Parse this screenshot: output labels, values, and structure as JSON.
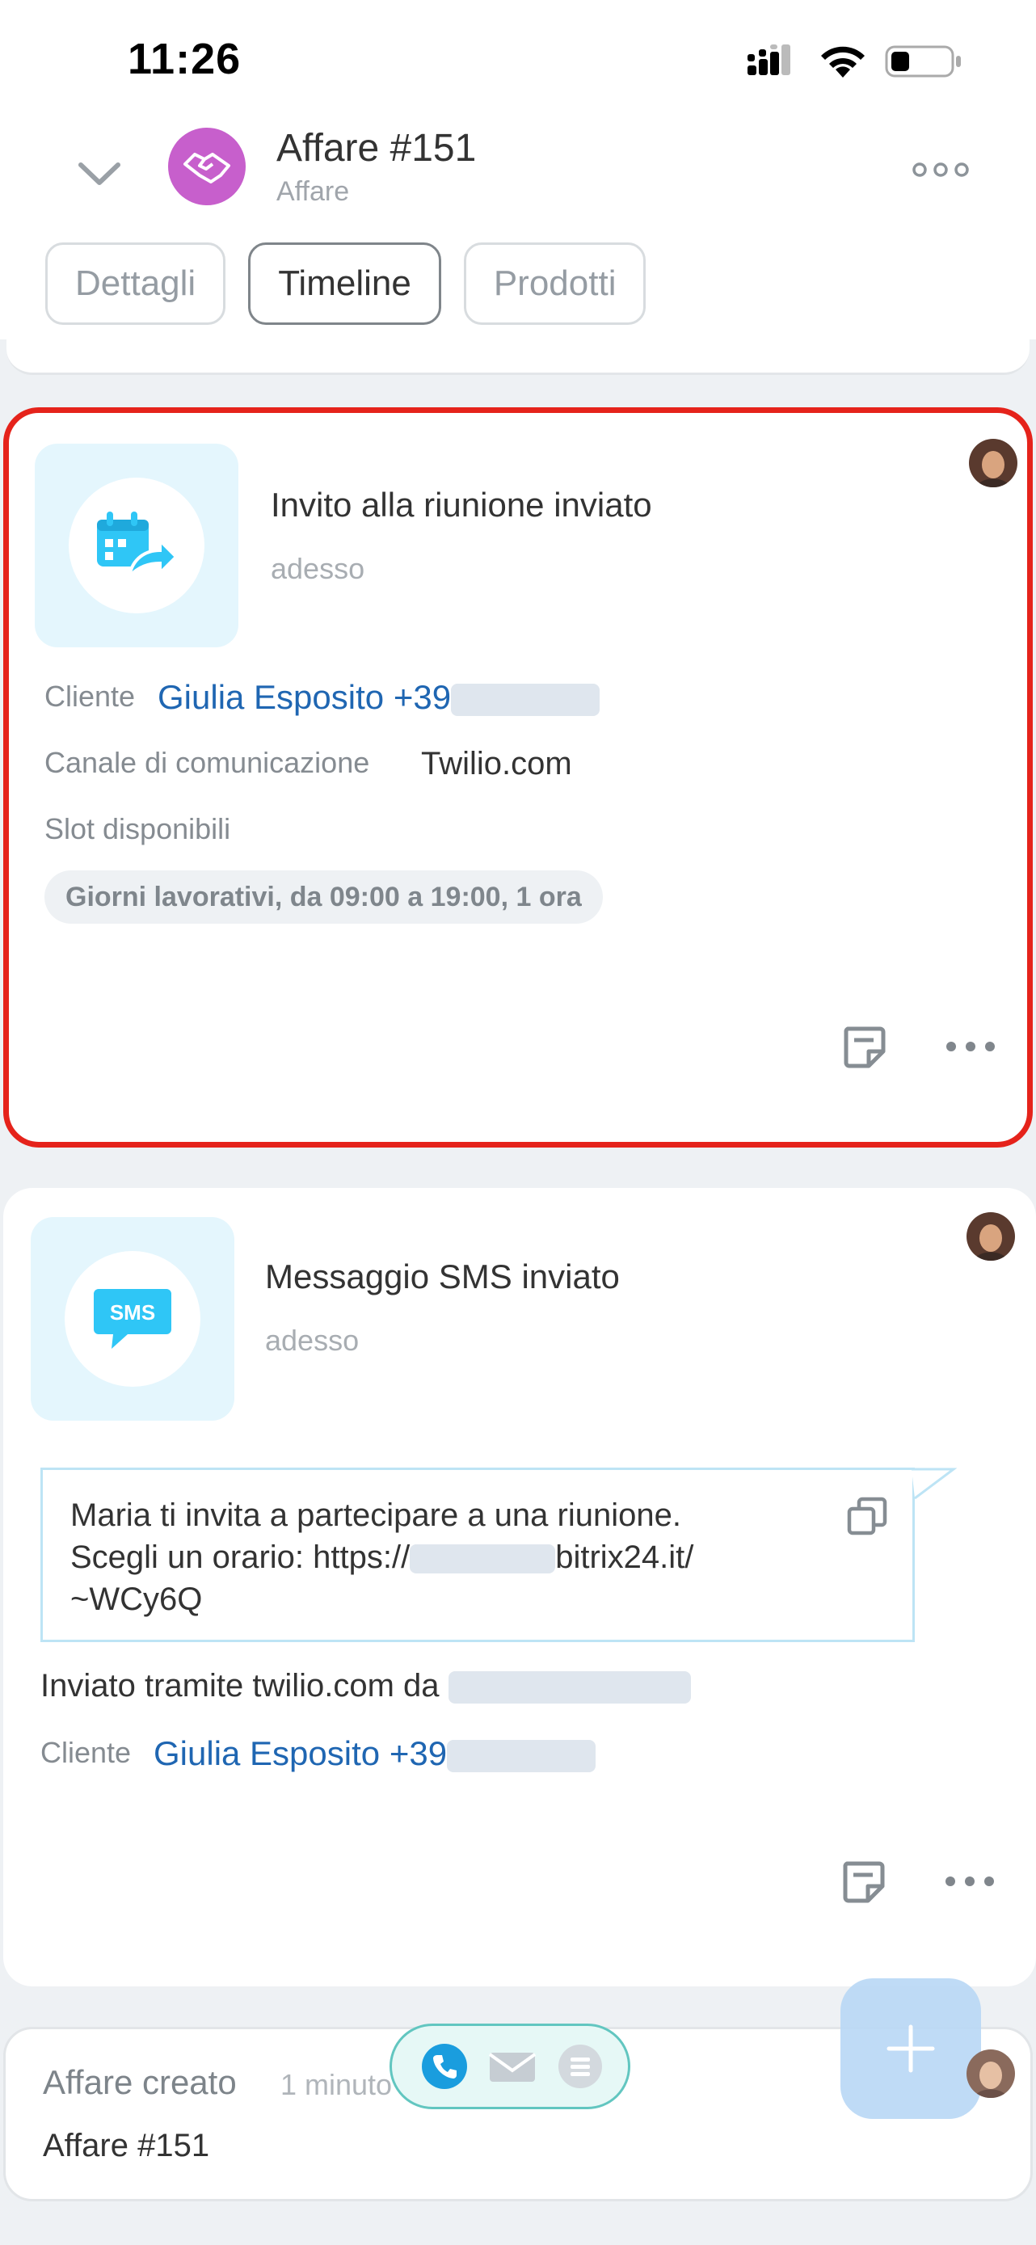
{
  "status_bar": {
    "time": "11:26"
  },
  "header": {
    "title": "Affare #151",
    "subtitle": "Affare"
  },
  "tabs": [
    {
      "label": "Dettagli",
      "active": false
    },
    {
      "label": "Timeline",
      "active": true
    },
    {
      "label": "Prodotti",
      "active": false
    }
  ],
  "cards": {
    "meeting": {
      "title": "Invito alla riunione inviato",
      "time": "adesso",
      "client_label": "Cliente",
      "client_name": "Giulia Esposito",
      "client_phone_prefix": "+39",
      "channel_label": "Canale di comunicazione",
      "channel_value": "Twilio.com",
      "slots_label": "Slot disponibili",
      "slots_value": "Giorni lavorativi, da 09:00 a 19:00, 1 ora",
      "icon": "calendar-share-icon"
    },
    "sms": {
      "title": "Messaggio SMS inviato",
      "time": "adesso",
      "message_line1": "Maria ti invita a partecipare a una riunione.",
      "message_line2_prefix": "Scegli un orario: https://",
      "message_line2_suffix": "bitrix24.it/",
      "message_line3": "~WCy6Q",
      "sent_via": "Inviato tramite twilio.com da",
      "client_label": "Cliente",
      "client_name": "Giulia Esposito",
      "client_phone_prefix": "+39",
      "icon": "sms-icon"
    },
    "created": {
      "title": "Affare creato",
      "time": "1 minuto",
      "value": "Affare #151"
    }
  },
  "colors": {
    "accent_link": "#1f66b2",
    "highlight_border": "#e5231b",
    "deal_avatar": "#c75fcc",
    "icon_blue": "#2fc6f6",
    "fab": "#b9d8f6"
  }
}
